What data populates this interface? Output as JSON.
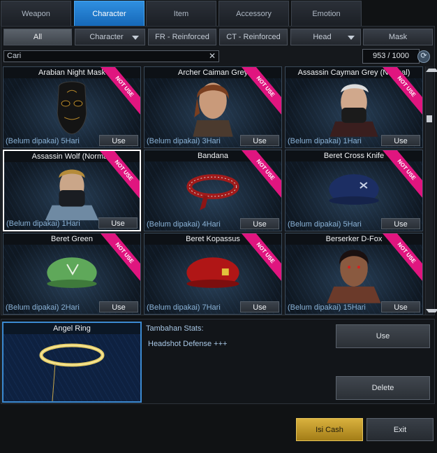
{
  "tabs": [
    {
      "label": "Weapon"
    },
    {
      "label": "Character"
    },
    {
      "label": "Item"
    },
    {
      "label": "Accessory"
    },
    {
      "label": "Emotion"
    }
  ],
  "active_tab": "Character",
  "filters": {
    "all": "All",
    "character": "Character",
    "fr": "FR - Reinforced",
    "ct": "CT - Reinforced",
    "head": "Head",
    "mask": "Mask"
  },
  "search": {
    "value": "Cari"
  },
  "counter": "953 / 1000",
  "badge_text": "NOT USE",
  "use_label": "Use",
  "items": [
    {
      "name": "Arabian Night Mask",
      "duration": "(Belum dipakai) 5Hari"
    },
    {
      "name": "Archer Caiman Grey",
      "duration": "(Belum dipakai) 3Hari"
    },
    {
      "name": "Assassin Cayman Grey (Normal)",
      "duration": "(Belum dipakai) 1Hari"
    },
    {
      "name": "Assassin Wolf (Normal)",
      "duration": "(Belum dipakai) 1Hari"
    },
    {
      "name": "Bandana",
      "duration": "(Belum dipakai) 4Hari"
    },
    {
      "name": "Beret Cross Knife",
      "duration": "(Belum dipakai) 5Hari"
    },
    {
      "name": "Beret Green",
      "duration": "(Belum dipakai) 2Hari"
    },
    {
      "name": "Beret Kopassus",
      "duration": "(Belum dipakai) 7Hari"
    },
    {
      "name": "Berserker D-Fox",
      "duration": "(Belum dipakai) 15Hari"
    }
  ],
  "preview": {
    "name": "Angel Ring",
    "stats_title": "Tambahan Stats:",
    "stats": "Headshot Defense +++"
  },
  "actions": {
    "use": "Use",
    "delete": "Delete",
    "cash": "Isi Cash",
    "exit": "Exit"
  },
  "colors": {
    "active_tab": "#1f7fd6",
    "badge": "#e0157f",
    "cash_button": "#c9a032"
  }
}
